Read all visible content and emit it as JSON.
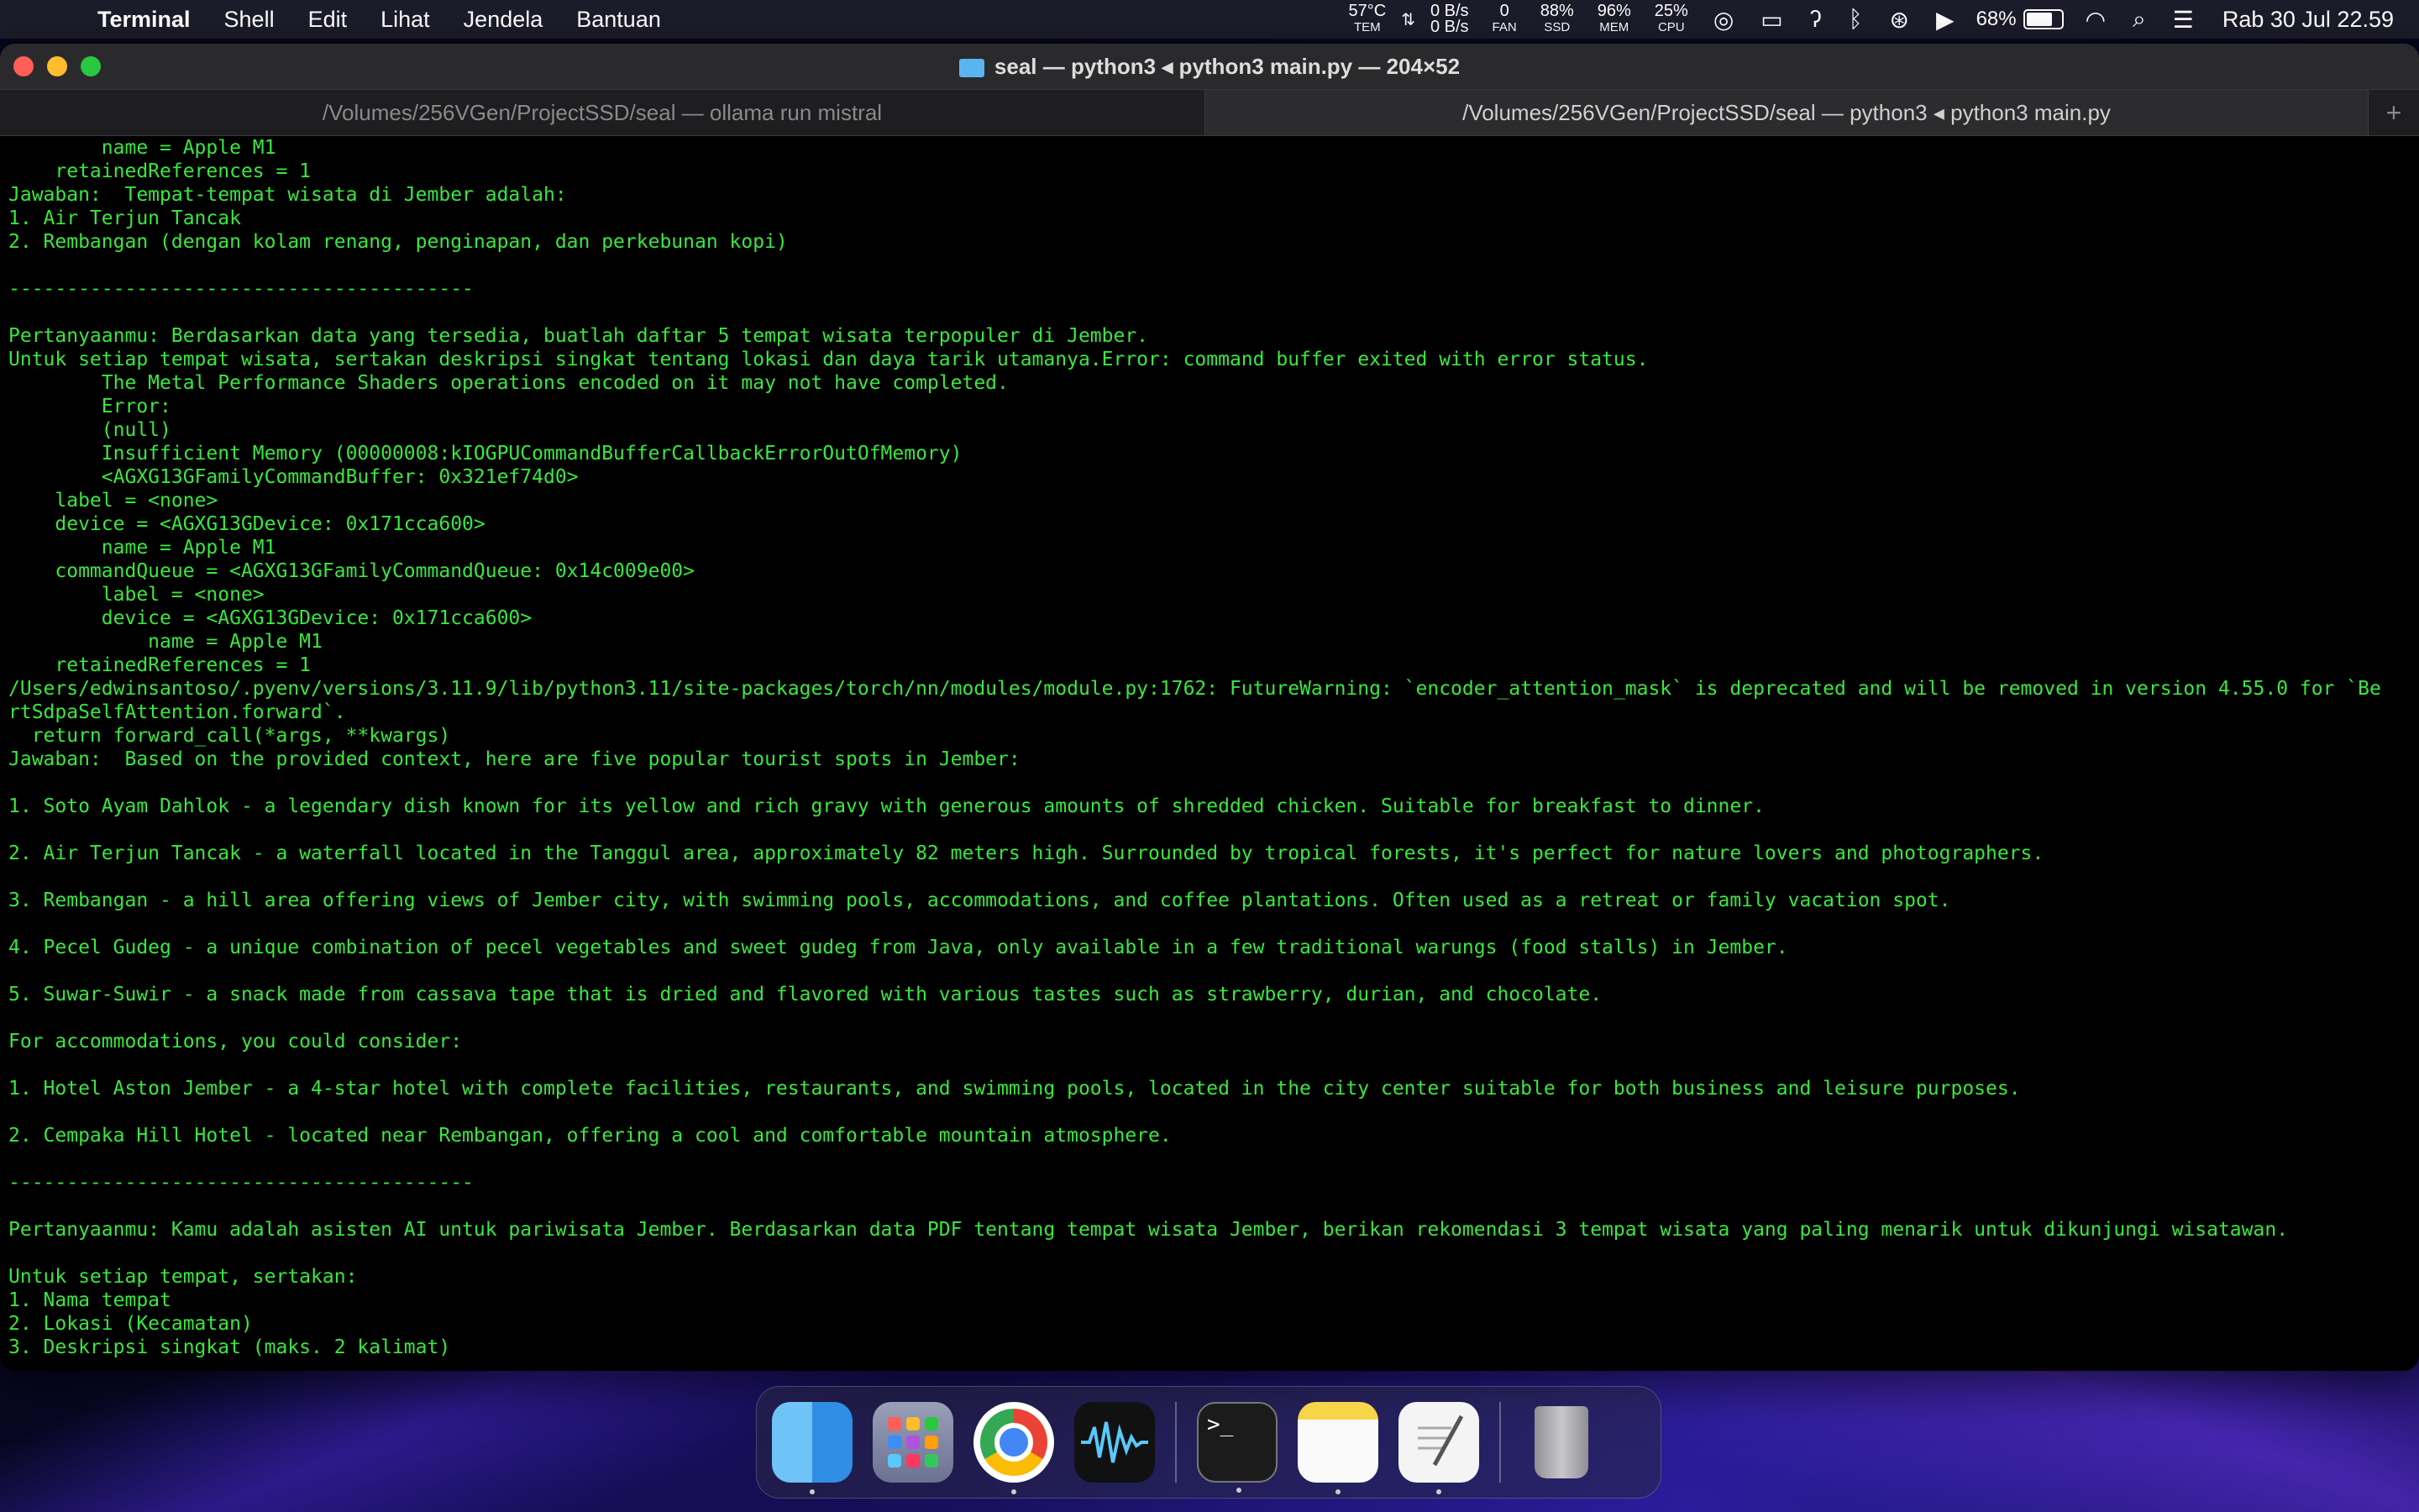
{
  "menubar": {
    "app_name": "Terminal",
    "items": [
      "Shell",
      "Edit",
      "Lihat",
      "Jendela",
      "Bantuan"
    ],
    "stats": [
      {
        "value": "57°C",
        "label": "TEM"
      },
      {
        "value": "0 B/s",
        "label": "0 B/s"
      },
      {
        "value": "0",
        "label": "FAN"
      },
      {
        "value": "88%",
        "label": "SSD"
      },
      {
        "value": "96%",
        "label": "MEM"
      },
      {
        "value": "25%",
        "label": "CPU"
      }
    ],
    "battery_percent": "68%",
    "clock": "Rab 30 Jul  22.59"
  },
  "window": {
    "title": "seal — python3 ◂ python3 main.py — 204×52",
    "tabs": [
      "/Volumes/256VGen/ProjectSSD/seal — ollama run mistral",
      "/Volumes/256VGen/ProjectSSD/seal — python3 ◂ python3 main.py"
    ],
    "add_tab": "+"
  },
  "terminal": {
    "lines": [
      "        name = Apple M1",
      "    retainedReferences = 1",
      "Jawaban:  Tempat-tempat wisata di Jember adalah:",
      "1. Air Terjun Tancak",
      "2. Rembangan (dengan kolam renang, penginapan, dan perkebunan kopi)",
      "",
      "----------------------------------------",
      "",
      "Pertanyaanmu: Berdasarkan data yang tersedia, buatlah daftar 5 tempat wisata terpopuler di Jember.",
      "Untuk setiap tempat wisata, sertakan deskripsi singkat tentang lokasi dan daya tarik utamanya.Error: command buffer exited with error status.",
      "        The Metal Performance Shaders operations encoded on it may not have completed.",
      "        Error:",
      "        (null)",
      "        Insufficient Memory (00000008:kIOGPUCommandBufferCallbackErrorOutOfMemory)",
      "        <AGXG13GFamilyCommandBuffer: 0x321ef74d0>",
      "    label = <none>",
      "    device = <AGXG13GDevice: 0x171cca600>",
      "        name = Apple M1",
      "    commandQueue = <AGXG13GFamilyCommandQueue: 0x14c009e00>",
      "        label = <none>",
      "        device = <AGXG13GDevice: 0x171cca600>",
      "            name = Apple M1",
      "    retainedReferences = 1",
      "/Users/edwinsantoso/.pyenv/versions/3.11.9/lib/python3.11/site-packages/torch/nn/modules/module.py:1762: FutureWarning: `encoder_attention_mask` is deprecated and will be removed in version 4.55.0 for `Be",
      "rtSdpaSelfAttention.forward`.",
      "  return forward_call(*args, **kwargs)",
      "Jawaban:  Based on the provided context, here are five popular tourist spots in Jember:",
      "",
      "1. Soto Ayam Dahlok - a legendary dish known for its yellow and rich gravy with generous amounts of shredded chicken. Suitable for breakfast to dinner.",
      "",
      "2. Air Terjun Tancak - a waterfall located in the Tanggul area, approximately 82 meters high. Surrounded by tropical forests, it's perfect for nature lovers and photographers.",
      "",
      "3. Rembangan - a hill area offering views of Jember city, with swimming pools, accommodations, and coffee plantations. Often used as a retreat or family vacation spot.",
      "",
      "4. Pecel Gudeg - a unique combination of pecel vegetables and sweet gudeg from Java, only available in a few traditional warungs (food stalls) in Jember.",
      "",
      "5. Suwar-Suwir - a snack made from cassava tape that is dried and flavored with various tastes such as strawberry, durian, and chocolate.",
      "",
      "For accommodations, you could consider:",
      "",
      "1. Hotel Aston Jember - a 4-star hotel with complete facilities, restaurants, and swimming pools, located in the city center suitable for both business and leisure purposes.",
      "",
      "2. Cempaka Hill Hotel - located near Rembangan, offering a cool and comfortable mountain atmosphere.",
      "",
      "----------------------------------------",
      "",
      "Pertanyaanmu: Kamu adalah asisten AI untuk pariwisata Jember. Berdasarkan data PDF tentang tempat wisata Jember, berikan rekomendasi 3 tempat wisata yang paling menarik untuk dikunjungi wisatawan.",
      "",
      "Untuk setiap tempat, sertakan:",
      "1. Nama tempat",
      "2. Lokasi (Kecamatan)",
      "3. Deskripsi singkat (maks. 2 kalimat)"
    ]
  },
  "colors": {
    "terminal_text": "#39e83d",
    "terminal_bg": "#000000",
    "menubar_bg": "#1c1c2a"
  },
  "dock": {
    "items": [
      {
        "icon": "finder-icon",
        "running": true
      },
      {
        "icon": "launchpad-icon",
        "running": false
      },
      {
        "icon": "chrome-icon",
        "running": true
      },
      {
        "icon": "voice-memos-icon",
        "running": false
      },
      {
        "icon": "terminal-icon",
        "running": true
      },
      {
        "icon": "notes-icon",
        "running": true
      },
      {
        "icon": "textedit-icon",
        "running": true
      },
      {
        "icon": "trash-icon",
        "running": false
      }
    ]
  }
}
